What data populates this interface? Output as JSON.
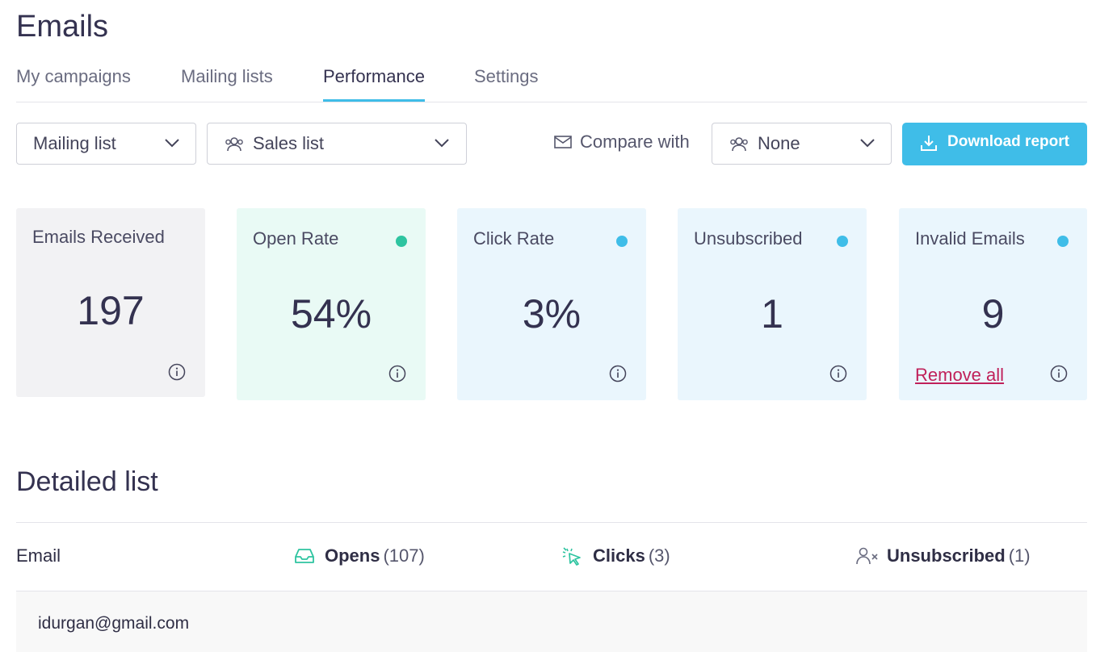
{
  "page": {
    "title": "Emails"
  },
  "tabs": [
    {
      "label": "My campaigns"
    },
    {
      "label": "Mailing lists"
    },
    {
      "label": "Performance",
      "active": true
    },
    {
      "label": "Settings"
    }
  ],
  "filters": {
    "type_select": "Mailing list",
    "list_select": "Sales list",
    "compare_label": "Compare with",
    "compare_select": "None",
    "download_label": "Download report"
  },
  "cards": [
    {
      "title": "Emails Received",
      "value": "197",
      "bg": "#f2f2f4",
      "dot": null
    },
    {
      "title": "Open Rate",
      "value": "54%",
      "bg": "#e9faf5",
      "dot": "#2ec4a0"
    },
    {
      "title": "Click Rate",
      "value": "3%",
      "bg": "#eaf6fd",
      "dot": "#3fbde8"
    },
    {
      "title": "Unsubscribed",
      "value": "1",
      "bg": "#eaf6fd",
      "dot": "#3fbde8"
    },
    {
      "title": "Invalid Emails",
      "value": "9",
      "bg": "#eaf6fd",
      "dot": "#3fbde8",
      "action": "Remove all"
    }
  ],
  "detailed": {
    "title": "Detailed list",
    "columns": {
      "email": "Email",
      "opens": {
        "label": "Opens",
        "count": "(107)",
        "icon": "inbox-icon",
        "color": "#2ec4a0"
      },
      "clicks": {
        "label": "Clicks",
        "count": "(3)",
        "icon": "cursor-click-icon",
        "color": "#2ec4a0"
      },
      "unsubscribed": {
        "label": "Unsubscribed",
        "count": "(1)",
        "icon": "user-remove-icon",
        "color": "#6a6c80"
      }
    },
    "rows": [
      {
        "email": "idurgan@gmail.com"
      }
    ]
  },
  "colors": {
    "accent": "#3fbde8",
    "danger": "#c0215a",
    "heading": "#343250"
  }
}
